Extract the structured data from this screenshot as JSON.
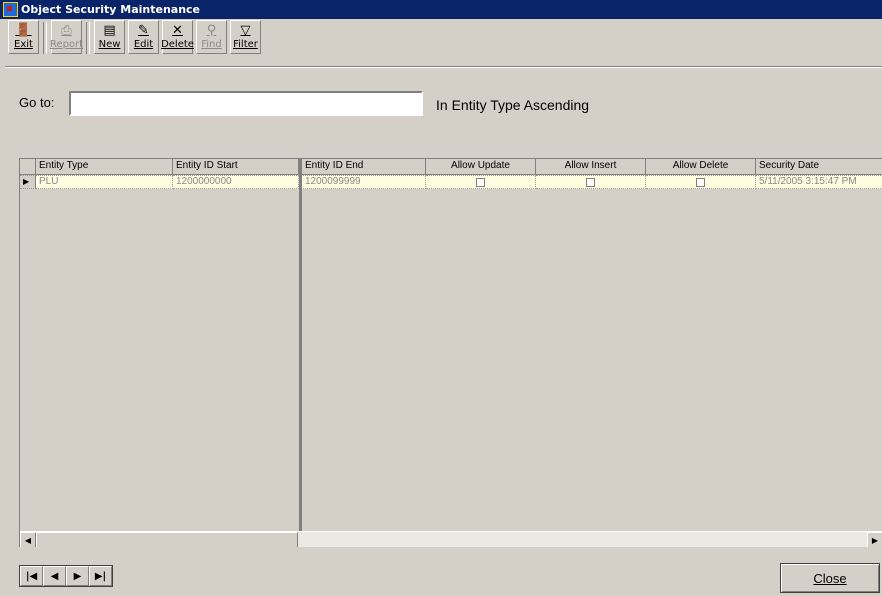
{
  "window": {
    "title": "Object Security Maintenance"
  },
  "toolbar": {
    "buttons": [
      {
        "label": "Exit",
        "icon": "exit-door-icon",
        "enabled": true
      },
      {
        "label": "Report",
        "icon": "printer-icon",
        "enabled": false
      },
      {
        "label": "New",
        "icon": "new-record-icon",
        "enabled": true
      },
      {
        "label": "Edit",
        "icon": "edit-record-icon",
        "enabled": true
      },
      {
        "label": "Delete",
        "icon": "delete-x-icon",
        "enabled": true
      },
      {
        "label": "Find",
        "icon": "binoculars-icon",
        "enabled": false
      },
      {
        "label": "Filter",
        "icon": "funnel-icon",
        "enabled": true
      }
    ]
  },
  "search": {
    "label": "Go to:",
    "value": "",
    "sort_text": "In Entity Type Ascending"
  },
  "grid": {
    "columns": [
      "Entity Type",
      "Entity ID Start",
      "Entity ID End",
      "Allow Update",
      "Allow Insert",
      "Allow Delete",
      "Security Date"
    ],
    "rows": [
      {
        "entity_type": "PLU",
        "entity_id_start": "1200000000",
        "entity_id_end": "1200099999",
        "allow_update": false,
        "allow_insert": false,
        "allow_delete": false,
        "security_date": "5/11/2005 3:15:47 PM"
      }
    ]
  },
  "navigation": {
    "first": "|◀",
    "prev": "◀",
    "next": "▶",
    "last": "▶|"
  },
  "footer": {
    "close_label": "Close"
  }
}
